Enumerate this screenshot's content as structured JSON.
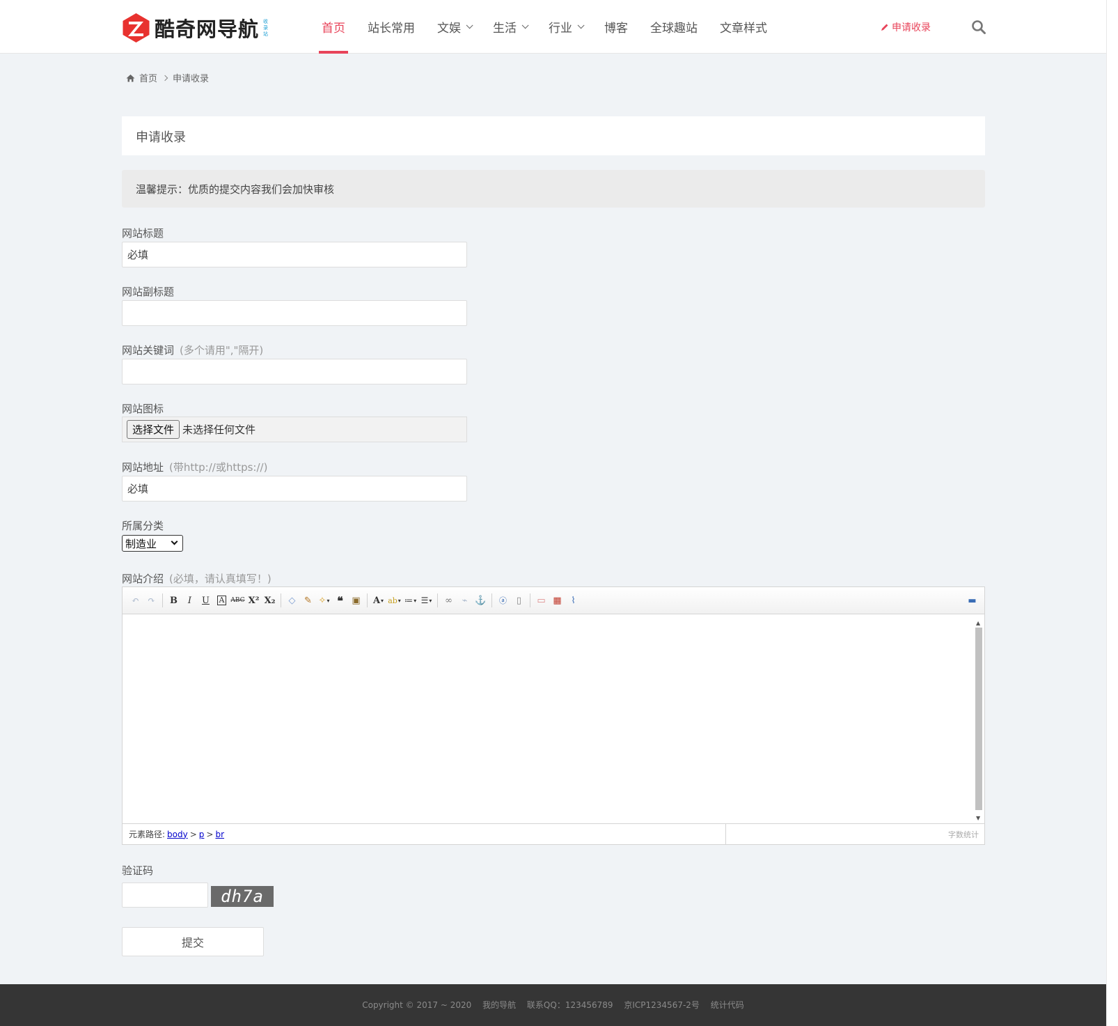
{
  "brand": {
    "name": "酷奇网导航",
    "sub": "收录站"
  },
  "nav": [
    {
      "label": "首页",
      "active": true,
      "dropdown": false
    },
    {
      "label": "站长常用",
      "active": false,
      "dropdown": false
    },
    {
      "label": "文娱",
      "active": false,
      "dropdown": true
    },
    {
      "label": "生活",
      "active": false,
      "dropdown": true
    },
    {
      "label": "行业",
      "active": false,
      "dropdown": true
    },
    {
      "label": "博客",
      "active": false,
      "dropdown": false
    },
    {
      "label": "全球趣站",
      "active": false,
      "dropdown": false
    },
    {
      "label": "文章样式",
      "active": false,
      "dropdown": false
    }
  ],
  "header": {
    "apply_label": "申请收录"
  },
  "breadcrumb": {
    "home": "首页",
    "current": "申请收录"
  },
  "page": {
    "title": "申请收录",
    "notice": "温馨提示：优质的提交内容我们会加快审核"
  },
  "form": {
    "title_label": "网站标题",
    "title_placeholder": "必填",
    "subtitle_label": "网站副标题",
    "keywords_label": "网站关键词",
    "keywords_hint": "(多个请用\",\"隔开)",
    "icon_label": "网站图标",
    "file_button": "选择文件",
    "file_status": "未选择任何文件",
    "url_label": "网站地址",
    "url_hint": "(带http://或https://)",
    "url_placeholder": "必填",
    "category_label": "所属分类",
    "category_value": "制造业",
    "intro_label": "网站介绍",
    "intro_hint": "(必填，请认真填写！)",
    "captcha_label": "验证码",
    "captcha_text": "dh7a",
    "submit_label": "提交"
  },
  "editor": {
    "path_label": "元素路径:",
    "path": [
      "body",
      "p",
      "br"
    ],
    "path_sep": ">",
    "word_count": "字数统计"
  },
  "footer": {
    "copyright": "Copyright © 2017 ~ 2020",
    "site": "我的导航",
    "qq": "联系QQ：123456789",
    "icp": "京ICP1234567-2号",
    "stats": "统计代码"
  },
  "colors": {
    "accent": "#e8445a",
    "page_bg": "#f0f3f6",
    "footer_bg": "#353535"
  }
}
